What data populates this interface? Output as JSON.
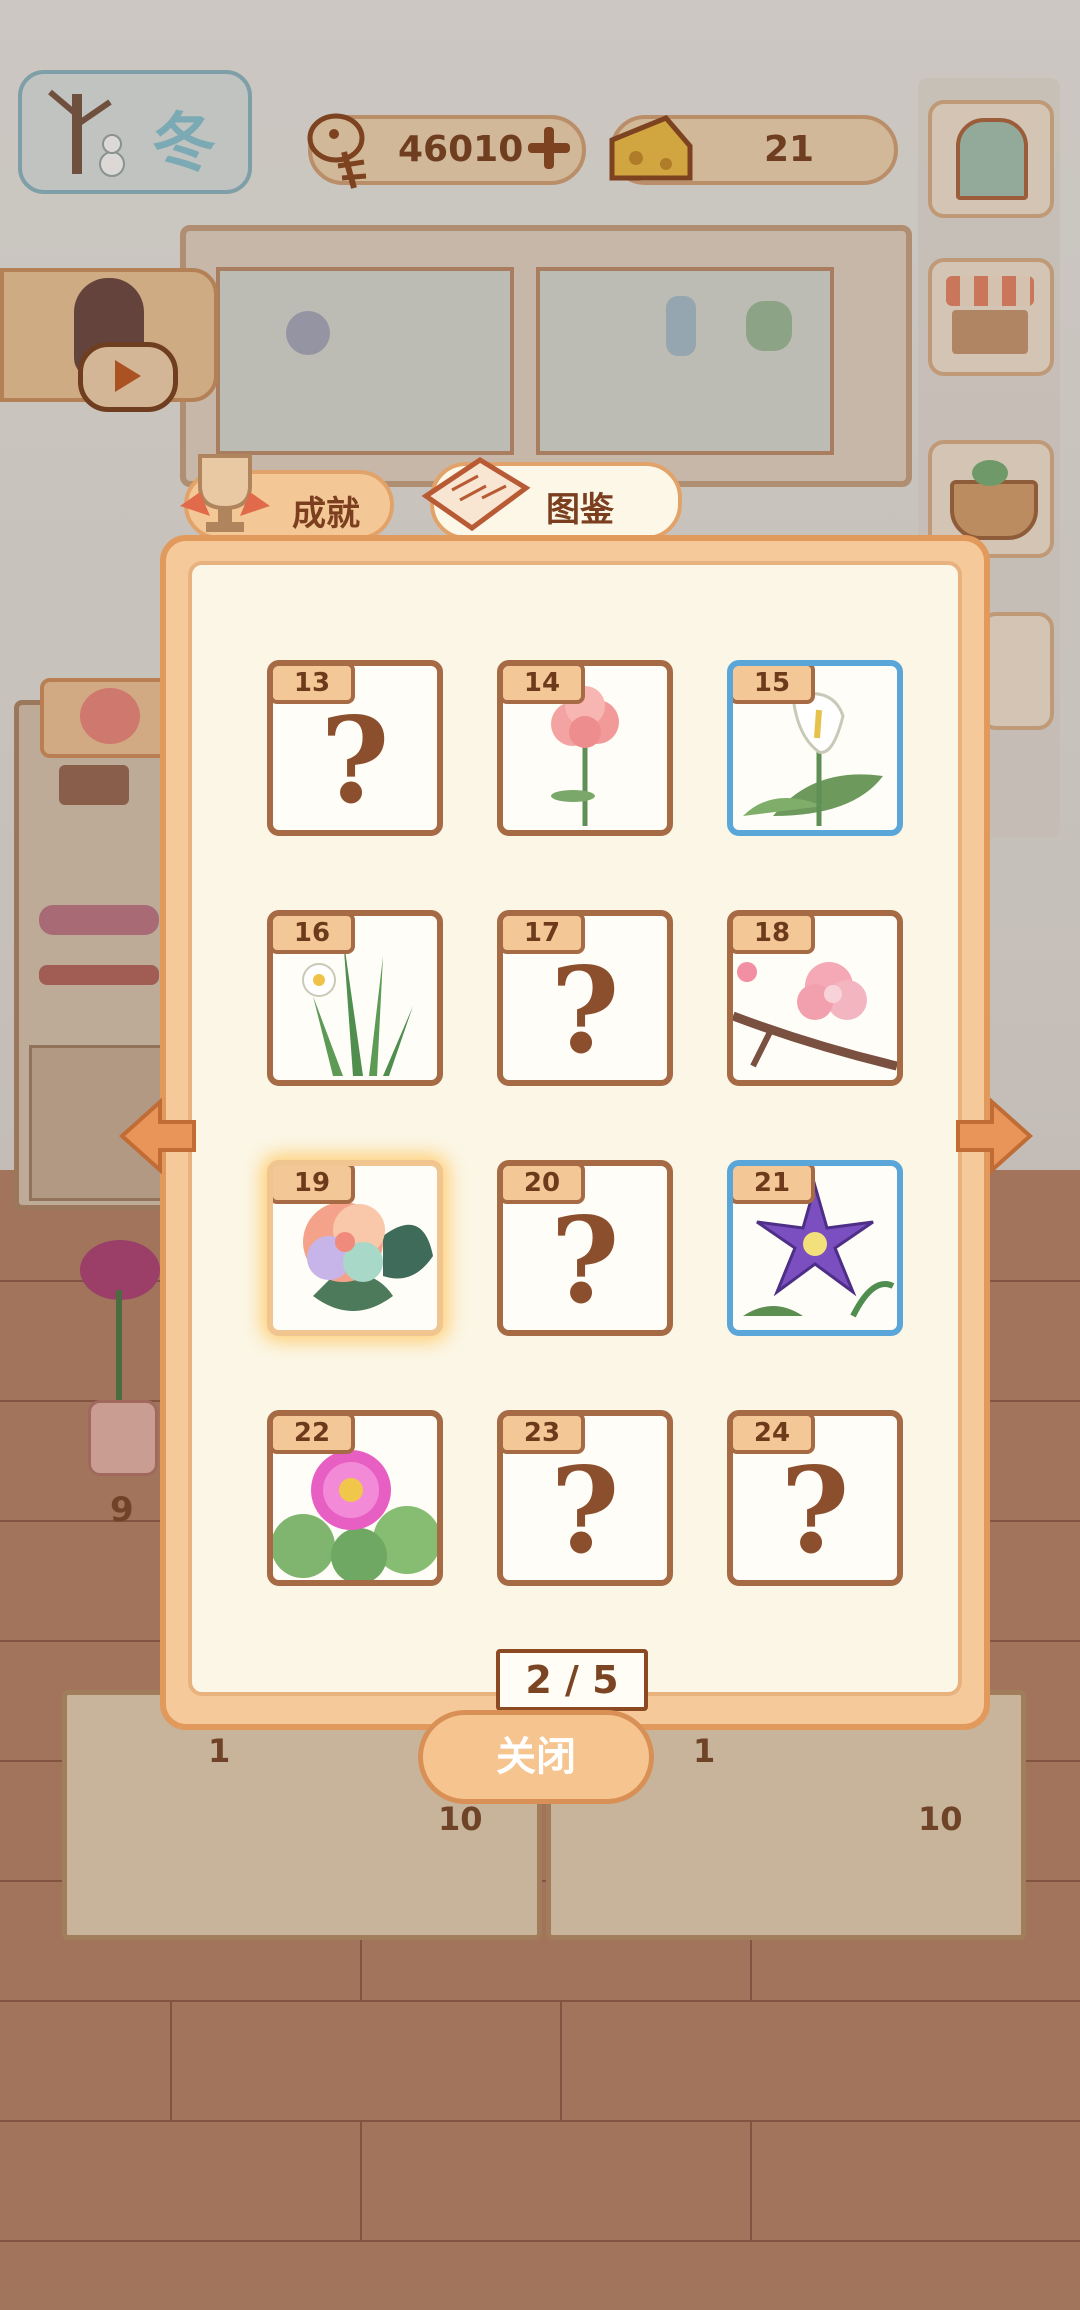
{
  "season": {
    "label": "冬"
  },
  "currency": {
    "fish": {
      "value": "46010",
      "icon": "fish-bone-icon"
    },
    "cheese": {
      "value": "21",
      "icon": "cheese-icon"
    }
  },
  "background": {
    "counters": [
      "9",
      "1",
      "10",
      "1",
      "10"
    ]
  },
  "tabs": {
    "achievements": {
      "label": "成就",
      "icon": "trophy-icon"
    },
    "collection": {
      "label": "图鉴",
      "icon": "book-icon",
      "active": true
    }
  },
  "collection": {
    "cards": [
      {
        "number": "13",
        "unlocked": false,
        "flower": "unknown"
      },
      {
        "number": "14",
        "unlocked": true,
        "flower": "pink-carnation"
      },
      {
        "number": "15",
        "unlocked": true,
        "flower": "white-calla-lily",
        "rarity": "rare"
      },
      {
        "number": "16",
        "unlocked": true,
        "flower": "narcissus"
      },
      {
        "number": "17",
        "unlocked": false,
        "flower": "unknown"
      },
      {
        "number": "18",
        "unlocked": true,
        "flower": "pink-blossom-branch"
      },
      {
        "number": "19",
        "unlocked": true,
        "flower": "rainbow-rose",
        "rarity": "special"
      },
      {
        "number": "20",
        "unlocked": false,
        "flower": "unknown"
      },
      {
        "number": "21",
        "unlocked": true,
        "flower": "purple-clematis",
        "rarity": "rare"
      },
      {
        "number": "22",
        "unlocked": true,
        "flower": "pink-gerbera"
      },
      {
        "number": "23",
        "unlocked": false,
        "flower": "unknown"
      },
      {
        "number": "24",
        "unlocked": false,
        "flower": "unknown"
      }
    ],
    "locked_symbol": "?",
    "page_indicator": "2 / 5"
  },
  "buttons": {
    "close": "关闭"
  },
  "colors": {
    "panel_border": "#e29a5c",
    "card_border": "#a66a45",
    "rare_border": "#5aa6d8",
    "text_brown": "#7b4422"
  }
}
